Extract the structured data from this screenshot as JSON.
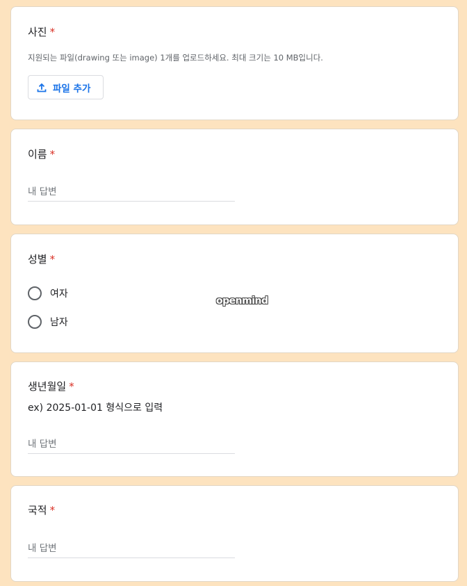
{
  "photo": {
    "title": "사진",
    "required_mark": "*",
    "hint": "지원되는 파일(drawing 또는 image) 1개를 업로드하세요. 최대 크기는 10 MB입니다.",
    "upload_label": "파일 추가",
    "upload_icon": "upload-icon"
  },
  "name": {
    "title": "이름",
    "required_mark": "*",
    "placeholder": "내 답변"
  },
  "gender": {
    "title": "성별",
    "required_mark": "*",
    "options": [
      "여자",
      "남자"
    ]
  },
  "birthdate": {
    "title": "생년월일",
    "required_mark": "*",
    "description": "ex) 2025-01-01 형식으로 입력",
    "placeholder": "내 답변"
  },
  "nationality": {
    "title": "국적",
    "required_mark": "*",
    "placeholder": "내 답변"
  },
  "watermark": "openmind",
  "colors": {
    "background": "#fde3bf",
    "accent": "#1a73e8",
    "required": "#d93025"
  }
}
